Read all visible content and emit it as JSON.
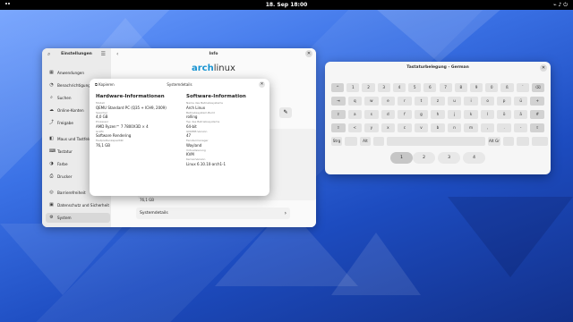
{
  "topbar": {
    "clock": "18. Sep  18:00",
    "icons": [
      "network-icon",
      "volume-icon",
      "power-icon"
    ]
  },
  "settings": {
    "sidebar_title": "Einstellungen",
    "items": [
      {
        "label": "Anwendungen",
        "icon": "apps-icon"
      },
      {
        "label": "Benachrichtigungen",
        "icon": "bell-icon"
      },
      {
        "label": "Suchen",
        "icon": "search-icon"
      },
      {
        "label": "Online-Konten",
        "icon": "cloud-icon"
      },
      {
        "label": "Freigabe",
        "icon": "share-icon"
      },
      {
        "label": "Maus und Tastfeld",
        "icon": "mouse-icon"
      },
      {
        "label": "Tastatur",
        "icon": "keyboard-icon"
      },
      {
        "label": "Farbe",
        "icon": "color-icon"
      },
      {
        "label": "Drucker",
        "icon": "printer-icon"
      },
      {
        "label": "Barrierefreiheit",
        "icon": "accessibility-icon"
      },
      {
        "label": "Datenschutz und Sicherheit",
        "icon": "lock-icon"
      },
      {
        "label": "System",
        "icon": "system-icon"
      }
    ],
    "main_title": "Info",
    "logo_text_a": "arch",
    "logo_text_b": "linux",
    "disk_value": "76,1 GB",
    "system_details_label": "Systemdetails"
  },
  "dialog": {
    "copy_label": "Kopieren",
    "title": "Systemdetails",
    "hardware_heading": "Hardware-Informationen",
    "software_heading": "Software-Information",
    "hardware": [
      {
        "k": "Modell",
        "v": "QEMU Standard PC (Q35 + ICH9, 2009)"
      },
      {
        "k": "Speicher",
        "v": "4,0 GB"
      },
      {
        "k": "Prozessor",
        "v": "AMD Ryzen™ 7 7800X3D × 4"
      },
      {
        "k": "Grafik",
        "v": "Software Rendering"
      },
      {
        "k": "Festplattenkapazität",
        "v": "76,1 GB"
      }
    ],
    "software": [
      {
        "k": "Name des Betriebssystems",
        "v": "Arch Linux"
      },
      {
        "k": "Betriebssystem-Build",
        "v": "rolling"
      },
      {
        "k": "Typ des Betriebssystems",
        "v": "64-bit"
      },
      {
        "k": "GNOME-Version",
        "v": "47"
      },
      {
        "k": "Fenstermanager",
        "v": "Wayland"
      },
      {
        "k": "Virtualisierung",
        "v": "KVM"
      },
      {
        "k": "Kernel-Version",
        "v": "Linux 6.10.10-arch1-1"
      }
    ]
  },
  "keyboard": {
    "title": "Tastaturbelegung - German",
    "row1": [
      "^",
      "1",
      "2",
      "3",
      "4",
      "5",
      "6",
      "7",
      "8",
      "9",
      "0",
      "ß",
      "´",
      "⌫"
    ],
    "row2": [
      "⇥",
      "q",
      "w",
      "e",
      "r",
      "t",
      "z",
      "u",
      "i",
      "o",
      "p",
      "ü",
      "+"
    ],
    "row3": [
      "⇪",
      "a",
      "s",
      "d",
      "f",
      "g",
      "h",
      "j",
      "k",
      "l",
      "ö",
      "ä",
      "#"
    ],
    "row4": [
      "⇧",
      "<",
      "y",
      "x",
      "c",
      "v",
      "b",
      "n",
      "m",
      ",",
      ".",
      "-",
      "⇧"
    ],
    "row5": [
      "Strg",
      "",
      "Alt",
      "",
      "",
      "Alt Gr",
      "",
      "",
      ""
    ],
    "levels": [
      "1",
      "2",
      "3",
      "4"
    ],
    "active_level": "1"
  }
}
